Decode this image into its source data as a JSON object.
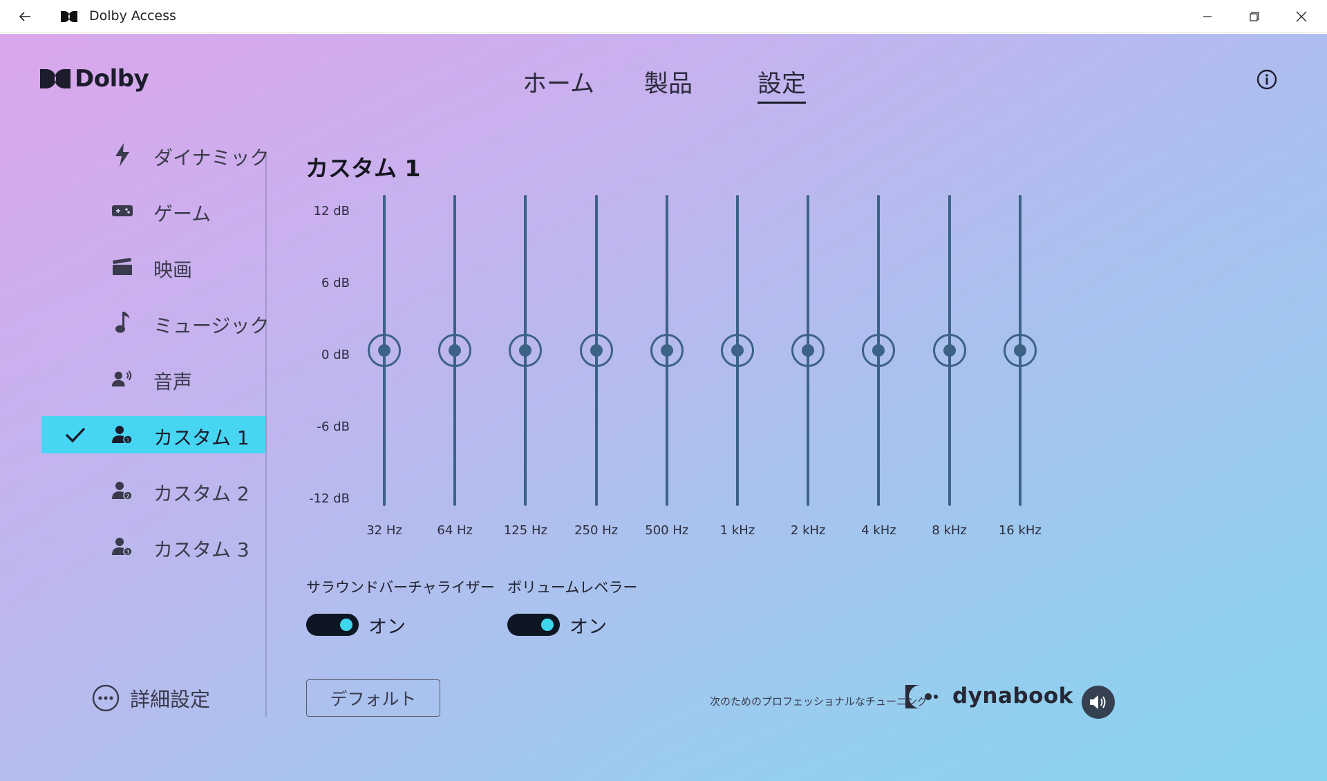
{
  "window": {
    "title": "Dolby Access"
  },
  "header": {
    "logo_text": "Dolby",
    "nav": [
      {
        "label": "ホーム",
        "active": false
      },
      {
        "label": "製品",
        "active": false
      },
      {
        "label": "設定",
        "active": true
      }
    ]
  },
  "sidebar": {
    "items": [
      {
        "label": "ダイナミック",
        "icon": "lightning-icon",
        "active": false
      },
      {
        "label": "ゲーム",
        "icon": "gamepad-icon",
        "active": false
      },
      {
        "label": "映画",
        "icon": "clapperboard-icon",
        "active": false
      },
      {
        "label": "ミュージック",
        "icon": "music-note-icon",
        "active": false
      },
      {
        "label": "音声",
        "icon": "voice-icon",
        "active": false
      },
      {
        "label": "カスタム 1",
        "icon": "person-1-icon",
        "active": true
      },
      {
        "label": "カスタム 2",
        "icon": "person-2-icon",
        "active": false
      },
      {
        "label": "カスタム 3",
        "icon": "person-3-icon",
        "active": false
      }
    ],
    "advanced_label": "詳細設定"
  },
  "equalizer": {
    "title": "カスタム 1",
    "db_labels": [
      "12 dB",
      "6 dB",
      "0 dB",
      "-6 dB",
      "-12 dB"
    ],
    "db_range": [
      -12,
      12
    ],
    "bands": [
      {
        "freq": "32 Hz",
        "gain": 0
      },
      {
        "freq": "64 Hz",
        "gain": 0
      },
      {
        "freq": "125 Hz",
        "gain": 0
      },
      {
        "freq": "250 Hz",
        "gain": 0
      },
      {
        "freq": "500 Hz",
        "gain": 0
      },
      {
        "freq": "1 kHz",
        "gain": 0
      },
      {
        "freq": "2 kHz",
        "gain": 0
      },
      {
        "freq": "4 kHz",
        "gain": 0
      },
      {
        "freq": "8 kHz",
        "gain": 0
      },
      {
        "freq": "16 kHz",
        "gain": 0
      }
    ]
  },
  "options": {
    "surround": {
      "label": "サラウンドバーチャライザー",
      "state": "オン"
    },
    "volume": {
      "label": "ボリュームレベラー",
      "state": "オン"
    }
  },
  "footer": {
    "default_button": "デフォルト",
    "tuning_text": "次のためのプロフェッショナルなチューニング",
    "brand_text": "dynabook"
  },
  "colors": {
    "accent": "#46d6f4",
    "slider": "#3c6286",
    "toggle_bg": "#0d1622",
    "toggle_knob": "#3dd6ec"
  }
}
